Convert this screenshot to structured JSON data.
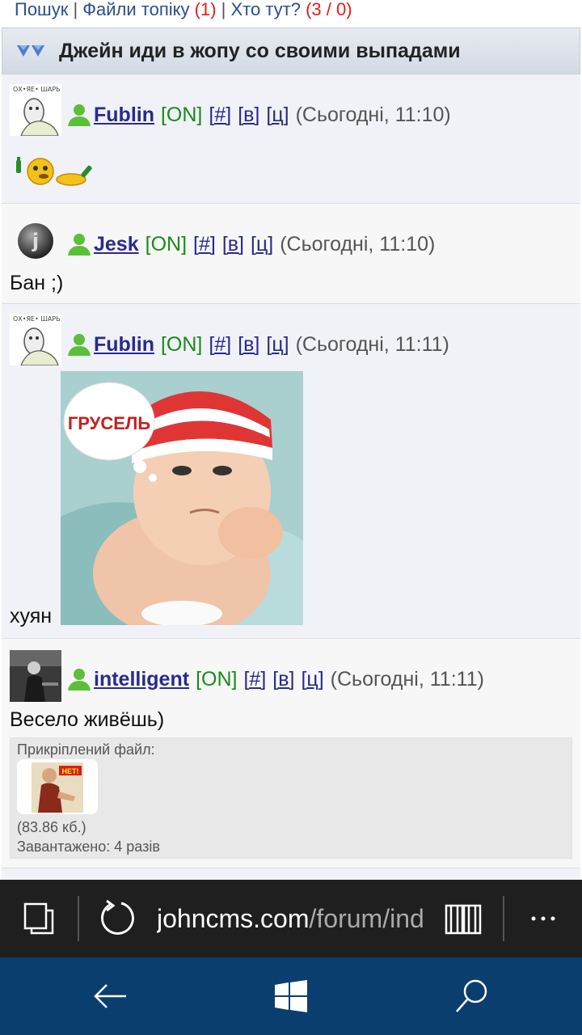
{
  "toplinks": {
    "search": "Пошук",
    "sep1": " | ",
    "files": "Файли топіку",
    "files_count": " (1)",
    "sep2": " | ",
    "who": "Хто тут?",
    "who_count": " (3 / 0)"
  },
  "topic": {
    "title": "Джейн иди в жопу со своими выпадами"
  },
  "posts": [
    {
      "nick": "Fublin",
      "status": "[ON]",
      "link_hash": "[#]",
      "link_v": "[в]",
      "link_ts": "[ц]",
      "time": "(Сьогодні, 11:10)"
    },
    {
      "nick": "Jesk",
      "status": "[ON]",
      "link_hash": "[#]",
      "link_v": "[в]",
      "link_ts": "[ц]",
      "time": "(Сьогодні, 11:10)",
      "text": "Бан ;)"
    },
    {
      "nick": "Fublin",
      "status": "[ON]",
      "link_hash": "[#]",
      "link_v": "[в]",
      "link_ts": "[ц]",
      "time": "(Сьогодні, 11:11)",
      "text": "хуян",
      "image_caption": "ГРУСЕЛЬ"
    },
    {
      "nick": "intelligent",
      "status": "[ON]",
      "link_hash": "[#]",
      "link_v": "[в]",
      "link_ts": "[ц]",
      "time": "(Сьогодні, 11:11)",
      "text": "Весело живёшь)",
      "attachment": {
        "label": "Прикріплений файл:",
        "thumb_text": "НЕТ!",
        "size": "(83.86 кб.)",
        "downloads": "Завантажено: 4 разів"
      }
    }
  ],
  "browser": {
    "url_host": "johncms.com",
    "url_path": "/forum/inde"
  },
  "colors": {
    "link": "#2a2a8c",
    "online": "#1b8a1b",
    "counter": "#e21b1b",
    "browser_bar": "#1f1f1f",
    "nav_bar": "#0a3e6f"
  }
}
